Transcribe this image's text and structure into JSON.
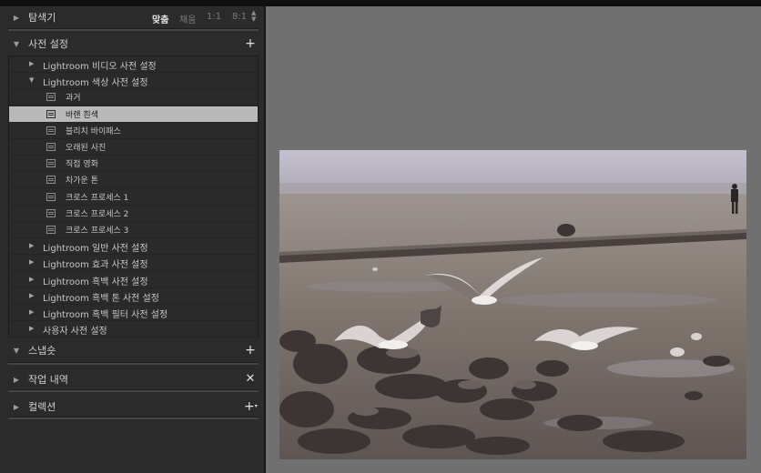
{
  "navigator": {
    "title": "탐색기",
    "zoom_fit": "맞춤",
    "zoom_fill": "채움",
    "zoom_1_1": "1:1",
    "zoom_8_1": "8:1"
  },
  "presets_panel": {
    "title": "사전 설정",
    "add_icon": "plus-icon",
    "folders": [
      {
        "label": "Lightroom 비디오 사전 설정",
        "expanded": false
      },
      {
        "label": "Lightroom 색상 사전 설정",
        "expanded": true,
        "presets": [
          "과거",
          "바랜 흰색",
          "블리치 바이패스",
          "오래된 사진",
          "직접 영화",
          "차가운 톤",
          "크로스 프로세스 1",
          "크로스 프로세스 2",
          "크로스 프로세스 3"
        ],
        "selected_index": 1
      },
      {
        "label": "Lightroom 일반 사전 설정",
        "expanded": false
      },
      {
        "label": "Lightroom 효과 사전 설정",
        "expanded": false
      },
      {
        "label": "Lightroom 흑백 사전 설정",
        "expanded": false
      },
      {
        "label": "Lightroom 흑백 톤 사전 설정",
        "expanded": false
      },
      {
        "label": "Lightroom 흑백 필터 사전 설정",
        "expanded": false
      },
      {
        "label": "사용자 사전 설정",
        "expanded": false
      }
    ]
  },
  "snapshots_panel": {
    "title": "스냅숏",
    "add_icon": "plus-icon"
  },
  "history_panel": {
    "title": "작업 내역",
    "clear_icon": "close-icon"
  },
  "collections_panel": {
    "title": "컬렉션",
    "add_icon": "plus-dropdown-icon"
  },
  "colors": {
    "panel_bg": "#2b2b2b",
    "view_bg": "#707070",
    "selected_row": "#b9b9b9"
  }
}
